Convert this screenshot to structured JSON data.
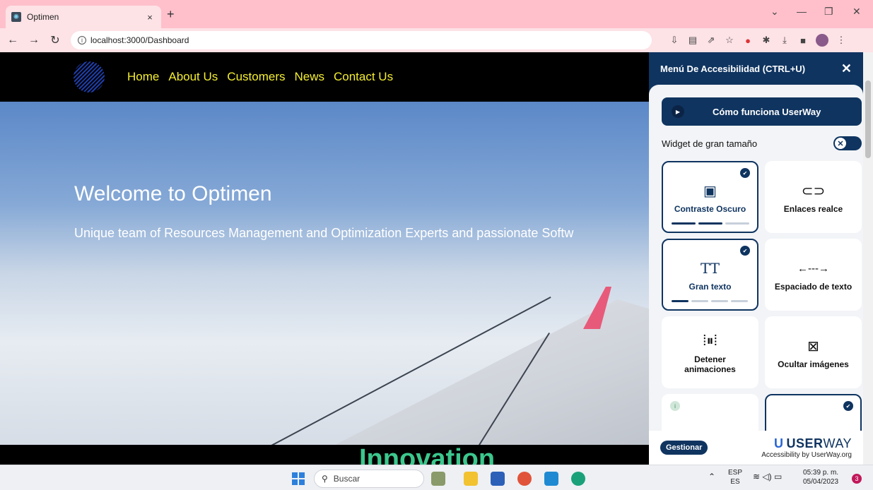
{
  "browser": {
    "tab_title": "Optimen",
    "tab_close": "×",
    "new_tab": "+",
    "url": "localhost:3000/Dashboard",
    "window_controls": [
      "⌄",
      "—",
      "❐",
      "✕"
    ]
  },
  "site": {
    "nav": [
      "Home",
      "About Us",
      "Customers",
      "News",
      "Contact Us"
    ],
    "hero_title": "Welcome to Optimen",
    "hero_subtitle": "Unique team of Resources Management and Optimization Experts and passionate Softw",
    "section_heading": "Innovation"
  },
  "userway": {
    "header_title": "Menú De Accesibilidad (CTRL+U)",
    "close": "✕",
    "video_button": "Cómo funciona UserWay",
    "large_widget_label": "Widget de gran tamaño",
    "toggle_glyph": "✕",
    "cards": [
      {
        "label": "Contraste Oscuro",
        "icon": "monitor-icon",
        "active": true
      },
      {
        "label": "Enlaces realce",
        "icon": "link-icon",
        "active": false
      },
      {
        "label": "Gran texto",
        "icon": "text-size-icon",
        "active": true
      },
      {
        "label": "Espaciado de texto",
        "icon": "text-spacing-icon",
        "active": false
      },
      {
        "label": "Detener animaciones",
        "icon": "pause-animation-icon",
        "active": false
      },
      {
        "label": "Ocultar imágenes",
        "icon": "hide-image-icon",
        "active": false
      }
    ],
    "manage_button": "Gestionar",
    "brand_bold": "USER",
    "brand_light": "WAY",
    "brand_sub": "Accessibility by UserWay.org"
  },
  "taskbar": {
    "search_label": "Buscar",
    "lang_top": "ESP",
    "lang_bottom": "ES",
    "time": "05:39 p. m.",
    "date": "05/04/2023",
    "notifications": "3"
  },
  "colors": {
    "accent": "#0f3460",
    "nav_text": "#f4ee30",
    "heading_green": "#3cc78d",
    "tabstrip": "#ffc0cb"
  }
}
